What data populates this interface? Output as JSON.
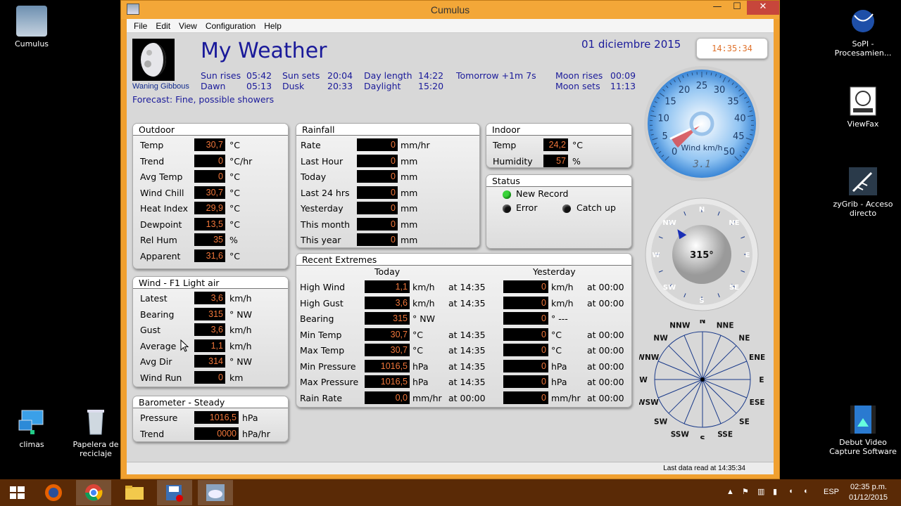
{
  "desktop": {
    "icons_left": [
      "Cumulus",
      "climas",
      "Papelera de reciclaje"
    ],
    "icons_right": [
      "SoPI - Procesamien...",
      "ViewFax",
      "zyGrib - Acceso directo",
      "Debut Video Capture Software"
    ]
  },
  "window": {
    "title": "Cumulus",
    "minimize": "—",
    "maximize": "☐",
    "close": "✕"
  },
  "menu": [
    "File",
    "Edit",
    "View",
    "Configuration",
    "Help"
  ],
  "header": {
    "moon_phase": "Waning Gibbous",
    "title": "My Weather",
    "date": "01 diciembre 2015",
    "time": "14:35:34",
    "sun_rises_label": "Sun rises",
    "sun_rises": "05:42",
    "sun_sets_label": "Sun sets",
    "sun_sets": "20:04",
    "day_length_label": "Day length",
    "day_length": "14:22",
    "tomorrow": "Tomorrow +1m 7s",
    "dawn_label": "Dawn",
    "dawn": "05:13",
    "dusk_label": "Dusk",
    "dusk": "20:33",
    "daylight_label": "Daylight",
    "daylight": "15:20",
    "moon_rises_label": "Moon rises",
    "moon_rises": "00:09",
    "moon_sets_label": "Moon sets",
    "moon_sets": "11:13",
    "forecast": "Forecast: Fine, possible showers"
  },
  "outdoor": {
    "title": "Outdoor",
    "rows": [
      {
        "label": "Temp",
        "value": "30,7",
        "unit": "°C"
      },
      {
        "label": "Trend",
        "value": "0",
        "unit": "°C/hr"
      },
      {
        "label": "Avg Temp",
        "value": "0",
        "unit": "°C"
      },
      {
        "label": "Wind Chill",
        "value": "30,7",
        "unit": "°C"
      },
      {
        "label": "Heat Index",
        "value": "29,9",
        "unit": "°C"
      },
      {
        "label": "Dewpoint",
        "value": "13,5",
        "unit": "°C"
      },
      {
        "label": "Rel Hum",
        "value": "35",
        "unit": "%"
      },
      {
        "label": "Apparent",
        "value": "31,6",
        "unit": "°C"
      }
    ]
  },
  "wind": {
    "title": "Wind - F1 Light air",
    "rows": [
      {
        "label": "Latest",
        "value": "3,6",
        "unit": "km/h"
      },
      {
        "label": "Bearing",
        "value": "315",
        "unit": "° NW"
      },
      {
        "label": "Gust",
        "value": "3,6",
        "unit": "km/h"
      },
      {
        "label": "Average",
        "value": "1,1",
        "unit": "km/h"
      },
      {
        "label": "Avg Dir",
        "value": "314",
        "unit": "° NW"
      },
      {
        "label": "Wind Run",
        "value": "0",
        "unit": "km"
      }
    ]
  },
  "barometer": {
    "title": "Barometer - Steady",
    "rows": [
      {
        "label": "Pressure",
        "value": "1016,5",
        "unit": "hPa"
      },
      {
        "label": "Trend",
        "value": "0000",
        "unit": "hPa/hr"
      }
    ]
  },
  "rainfall": {
    "title": "Rainfall",
    "rows": [
      {
        "label": "Rate",
        "value": "0",
        "unit": "mm/hr"
      },
      {
        "label": "Last Hour",
        "value": "0",
        "unit": "mm"
      },
      {
        "label": "Today",
        "value": "0",
        "unit": "mm"
      },
      {
        "label": "Last 24 hrs",
        "value": "0",
        "unit": "mm"
      },
      {
        "label": "Yesterday",
        "value": "0",
        "unit": "mm"
      },
      {
        "label": "This month",
        "value": "0",
        "unit": "mm"
      },
      {
        "label": "This year",
        "value": "0",
        "unit": "mm"
      }
    ]
  },
  "indoor": {
    "title": "Indoor",
    "rows": [
      {
        "label": "Temp",
        "value": "24,2",
        "unit": "°C"
      },
      {
        "label": "Humidity",
        "value": "57",
        "unit": "%"
      }
    ]
  },
  "status": {
    "title": "Status",
    "new_record": "New Record",
    "error": "Error",
    "catch_up": "Catch up",
    "colors": {
      "new_record": "#3ad43a",
      "error": "#111111",
      "catch_up": "#111111"
    }
  },
  "extremes": {
    "title": "Recent Extremes",
    "today_label": "Today",
    "yesterday_label": "Yesterday",
    "rows": [
      {
        "label": "High Wind",
        "t_val": "1,1",
        "t_unit": "km/h",
        "t_at": "at 14:35",
        "y_val": "0",
        "y_unit": "km/h",
        "y_at": "at 00:00"
      },
      {
        "label": "High Gust",
        "t_val": "3,6",
        "t_unit": "km/h",
        "t_at": "at 14:35",
        "y_val": "0",
        "y_unit": "km/h",
        "y_at": "at 00:00"
      },
      {
        "label": "Bearing",
        "t_val": "315",
        "t_unit": "°  NW",
        "t_at": "",
        "y_val": "0",
        "y_unit": "°  ---",
        "y_at": ""
      },
      {
        "label": "Min Temp",
        "t_val": "30,7",
        "t_unit": "°C",
        "t_at": "at 14:35",
        "y_val": "0",
        "y_unit": "°C",
        "y_at": "at 00:00"
      },
      {
        "label": "Max Temp",
        "t_val": "30,7",
        "t_unit": "°C",
        "t_at": "at 14:35",
        "y_val": "0",
        "y_unit": "°C",
        "y_at": "at 00:00"
      },
      {
        "label": "Min Pressure",
        "t_val": "1016,5",
        "t_unit": "hPa",
        "t_at": "at 14:35",
        "y_val": "0",
        "y_unit": "hPa",
        "y_at": "at 00:00"
      },
      {
        "label": "Max Pressure",
        "t_val": "1016,5",
        "t_unit": "hPa",
        "t_at": "at 14:35",
        "y_val": "0",
        "y_unit": "hPa",
        "y_at": "at 00:00"
      },
      {
        "label": "Rain Rate",
        "t_val": "0,0",
        "t_unit": "mm/hr",
        "t_at": "at 00:00",
        "y_val": "0",
        "y_unit": "mm/hr",
        "y_at": "at 00:00"
      }
    ]
  },
  "wind_gauge": {
    "ticks": [
      "0",
      "5",
      "10",
      "15",
      "20",
      "25",
      "30",
      "35",
      "40",
      "45",
      "50"
    ],
    "label": "Wind km/h",
    "lcd": "3.1",
    "needle_value": 3.6,
    "max": 50
  },
  "compass": {
    "bearing_text": "315°",
    "bearing": 315,
    "points": [
      "N",
      "NE",
      "E",
      "SE",
      "S",
      "SW",
      "W",
      "NW"
    ]
  },
  "rose": {
    "points": [
      "N",
      "NNE",
      "NE",
      "ENE",
      "E",
      "ESE",
      "SE",
      "SSE",
      "S",
      "SSW",
      "SW",
      "WSW",
      "W",
      "WNW",
      "NW",
      "NNW"
    ]
  },
  "statusbar": {
    "text": "Last data read at 14:35:34"
  },
  "taskbar": {
    "language": "ESP",
    "time": "02:35 p.m.",
    "date": "01/12/2015"
  },
  "colors": {
    "value_text": "#f0763a",
    "title_text": "#1a1a9a",
    "taskbar": "#5a2a06",
    "window_frame": "#f0a030"
  }
}
